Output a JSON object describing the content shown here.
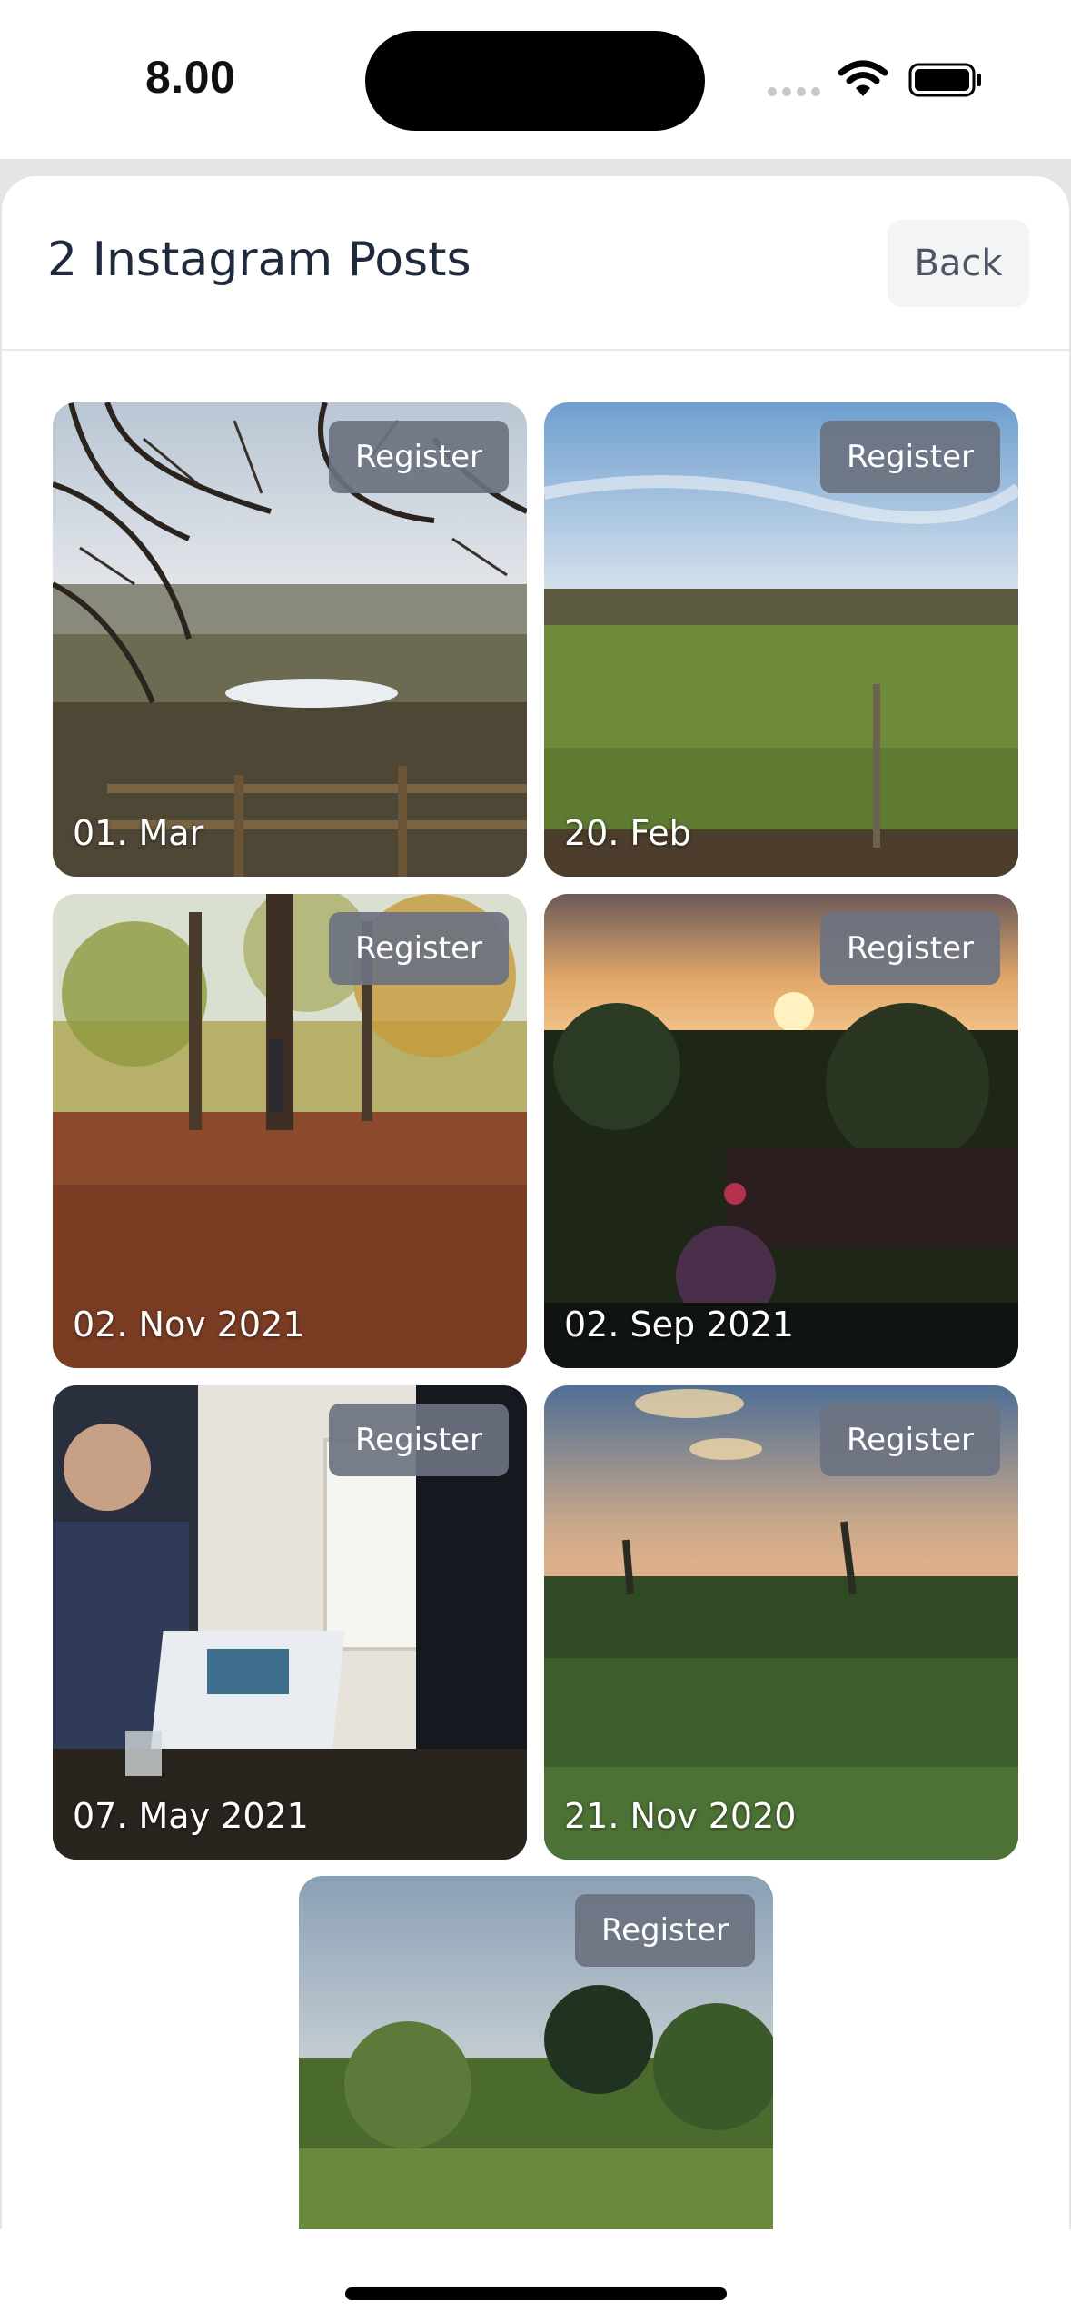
{
  "status_bar": {
    "time": "8.00"
  },
  "header": {
    "title": "2 Instagram Posts",
    "back_label": "Back"
  },
  "posts": [
    {
      "date": "01. Mar",
      "register_label": "Register",
      "image": "bare-trees-field-pond"
    },
    {
      "date": "20. Feb",
      "register_label": "Register",
      "image": "green-field-blue-sky"
    },
    {
      "date": "02. Nov 2021",
      "register_label": "Register",
      "image": "autumn-forest-leaves"
    },
    {
      "date": "02. Sep 2021",
      "register_label": "Register",
      "image": "sunset-garden"
    },
    {
      "date": "07. May 2021",
      "register_label": "Register",
      "image": "people-with-laptop"
    },
    {
      "date": "21. Nov 2020",
      "register_label": "Register",
      "image": "evening-sky-bushes"
    },
    {
      "date": "",
      "register_label": "Register",
      "image": "trees-cloudy-sky"
    }
  ],
  "colors": {
    "register_bg": "#6b7280",
    "back_bg": "#f3f4f6",
    "title": "#1f2a3d"
  }
}
